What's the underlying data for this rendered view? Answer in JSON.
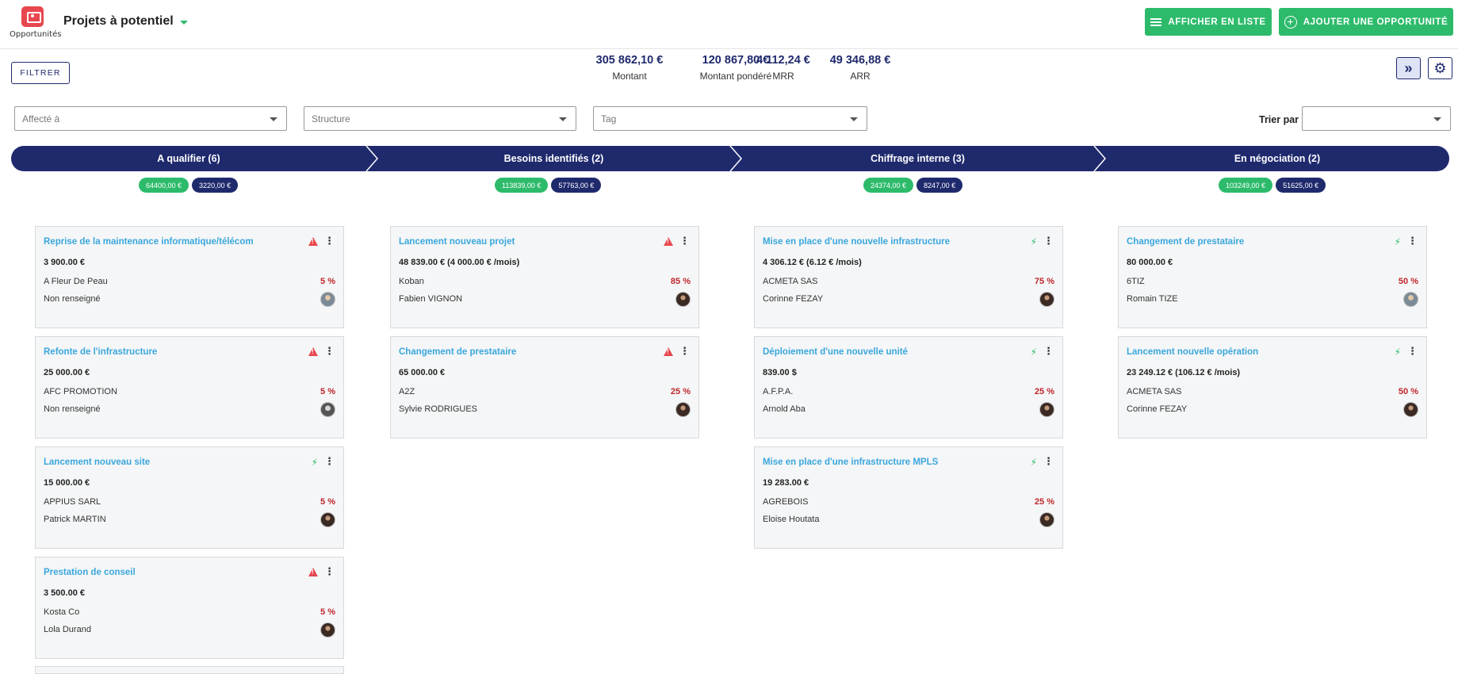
{
  "app": {
    "label": "Opportunités",
    "icon": "opportunities-icon"
  },
  "header": {
    "title": "Projets à potentiel"
  },
  "actions": {
    "list_view": "AFFICHER EN LISTE",
    "add": "AJOUTER UNE OPPORTUNITÉ"
  },
  "toolbar": {
    "filter": "FILTRER"
  },
  "stats": [
    {
      "value": "305 862,10 €",
      "label": "Montant"
    },
    {
      "value": "120 867,80 €",
      "label": "Montant pondéré"
    },
    {
      "value": "4 112,24 €",
      "label": "MRR"
    },
    {
      "value": "49 346,88 €",
      "label": "ARR"
    }
  ],
  "filters": {
    "assigned": "Affecté à",
    "structure": "Structure",
    "tag": "Tag",
    "sort_label": "Trier par :",
    "sort_value": ""
  },
  "colors": {
    "navy": "#1f2a6d",
    "green": "#2dbb6b",
    "red": "#c0262d",
    "title_blue": "#3aa7dd"
  },
  "stages": [
    {
      "title": "A qualifier (6)",
      "total": "64400,00 €",
      "weighted": "3220,00 €"
    },
    {
      "title": "Besoins identifiés (2)",
      "total": "113839,00 €",
      "weighted": "57763,00 €"
    },
    {
      "title": "Chiffrage interne (3)",
      "total": "24374,00 €",
      "weighted": "8247,00 €"
    },
    {
      "title": "En négociation (2)",
      "total": "103249,00 €",
      "weighted": "51625,00 €"
    }
  ],
  "cards": [
    [
      {
        "title": "Reprise de la maintenance informatique/télécom",
        "amount": "3 900.00 €",
        "company": "A Fleur De Peau",
        "probability": "5 %",
        "owner": "Non renseigné",
        "status_icon": "warning-icon"
      },
      {
        "title": "Refonte de l'infrastructure",
        "amount": "25 000.00 €",
        "company": "AFC PROMOTION",
        "probability": "5 %",
        "owner": "Non renseigné",
        "status_icon": "warning-icon"
      },
      {
        "title": "Lancement nouveau site",
        "amount": "15 000.00 €",
        "company": "APPIUS SARL",
        "probability": "5 %",
        "owner": "Patrick MARTIN",
        "status_icon": "bolt-icon"
      },
      {
        "title": "Prestation de conseil",
        "amount": "3 500.00 €",
        "company": "Kosta Co",
        "probability": "5 %",
        "owner": "Lola Durand",
        "status_icon": "warning-icon"
      }
    ],
    [
      {
        "title": "Lancement nouveau projet",
        "amount": "48 839.00 € (4 000.00 € /mois)",
        "company": "Koban",
        "probability": "85 %",
        "owner": "Fabien VIGNON",
        "status_icon": "warning-icon"
      },
      {
        "title": "Changement de prestataire",
        "amount": "65 000.00 €",
        "company": "A2Z",
        "probability": "25 %",
        "owner": "Sylvie RODRIGUES",
        "status_icon": "warning-icon"
      }
    ],
    [
      {
        "title": "Mise en place d'une nouvelle infrastructure",
        "amount": "4 306.12 € (6.12 € /mois)",
        "company": "ACMETA SAS",
        "probability": "75 %",
        "owner": "Corinne FEZAY",
        "status_icon": "bolt-icon"
      },
      {
        "title": "Déploiement d'une nouvelle unité",
        "amount": "839.00 $",
        "company": "A.F.P.A.",
        "probability": "25 %",
        "owner": "Arnold Aba",
        "status_icon": "bolt-icon"
      },
      {
        "title": "Mise en place d'une infrastructure MPLS",
        "amount": "19 283.00 €",
        "company": "AGREBOIS",
        "probability": "25 %",
        "owner": "Eloise Houtata",
        "status_icon": "bolt-icon"
      }
    ],
    [
      {
        "title": "Changement de prestataire",
        "amount": "80 000.00 €",
        "company": "6TIZ",
        "probability": "50 %",
        "owner": "Romain TIZE",
        "status_icon": "bolt-icon"
      },
      {
        "title": "Lancement nouvelle opération",
        "amount": "23 249.12 € (106.12 € /mois)",
        "company": "ACMETA SAS",
        "probability": "50 %",
        "owner": "Corinne FEZAY",
        "status_icon": "bolt-icon"
      }
    ]
  ]
}
